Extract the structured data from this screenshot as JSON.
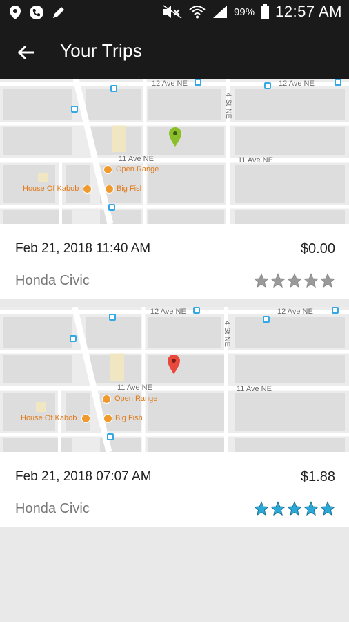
{
  "status_bar": {
    "battery": "99%",
    "time": "12:57 AM",
    "icons": [
      "location-icon",
      "phone-icon",
      "pen-icon",
      "mute-icon",
      "wifi-icon",
      "signal-icon",
      "battery-icon"
    ]
  },
  "app_bar": {
    "title": "Your Trips",
    "back_icon": "arrow-left-icon"
  },
  "trips": [
    {
      "date": "Feb 21, 2018 11:40 AM",
      "fare": "$0.00",
      "car": "Honda Civic",
      "rating": 0,
      "rating_max": 5,
      "pin_color": "#8bbf29",
      "map": {
        "streets": [
          "12 Ave NE",
          "12 Ave NE",
          "11 Ave NE",
          "11 Ave NE",
          "4 St NE"
        ],
        "pois": [
          "Open Range",
          "House Of Kabob",
          "Big Fish"
        ]
      }
    },
    {
      "date": "Feb 21, 2018 07:07 AM",
      "fare": "$1.88",
      "car": "Honda Civic",
      "rating": 5,
      "rating_max": 5,
      "pin_color": "#e8493c",
      "map": {
        "streets": [
          "12 Ave NE",
          "12 Ave NE",
          "11 Ave NE",
          "11 Ave NE",
          "4 St NE"
        ],
        "pois": [
          "Open Range",
          "House Of Kabob",
          "Big Fish"
        ]
      }
    }
  ],
  "colors": {
    "bar_bg": "#1a1a1a",
    "star_filled": "#29a9d8",
    "star_empty": "#9a9a9a"
  }
}
